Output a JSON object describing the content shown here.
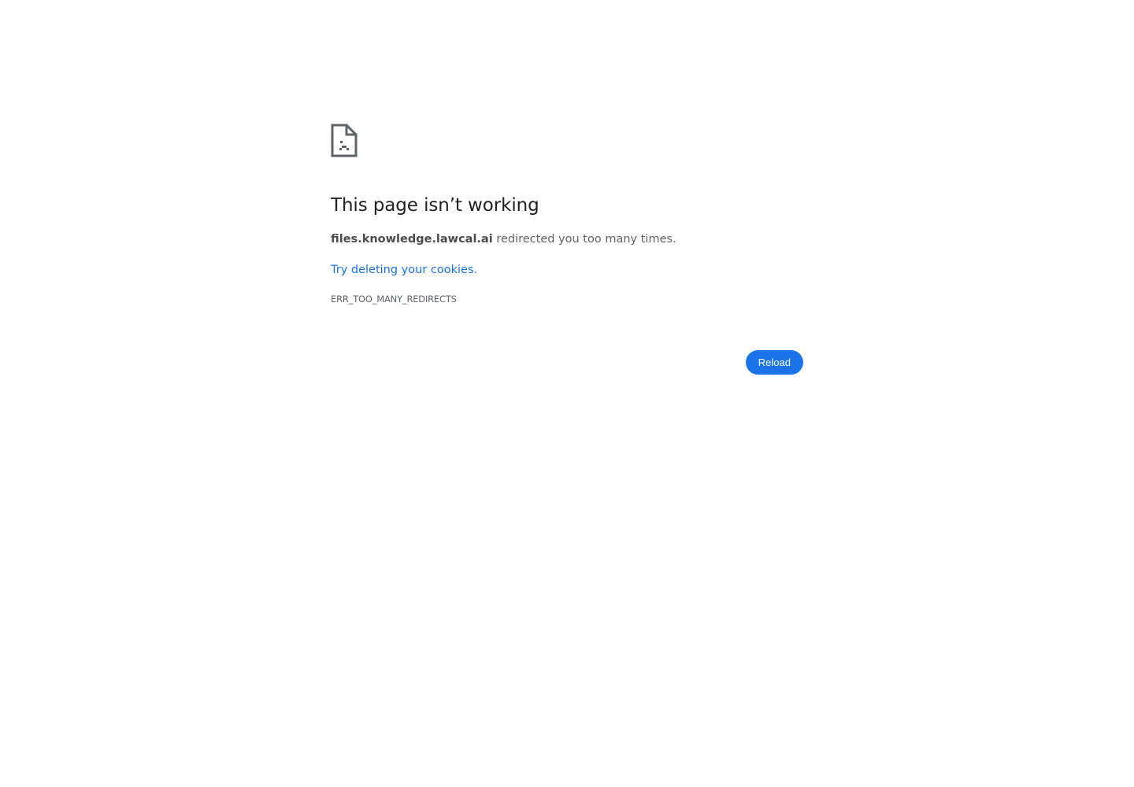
{
  "error_page": {
    "icon": "sad-document-icon",
    "heading": "This page isn’t working",
    "summary_host": "files.knowledge.lawcal.ai",
    "summary_text": " redirected you too many times.",
    "suggestion_link": "Try deleting your cookies.",
    "error_code": "ERR_TOO_MANY_REDIRECTS",
    "reload_label": "Reload"
  },
  "colors": {
    "heading": "#202124",
    "body_text": "#5f6368",
    "link": "#1a73e8",
    "button_bg": "#1a73e8",
    "button_text": "#ffffff"
  }
}
